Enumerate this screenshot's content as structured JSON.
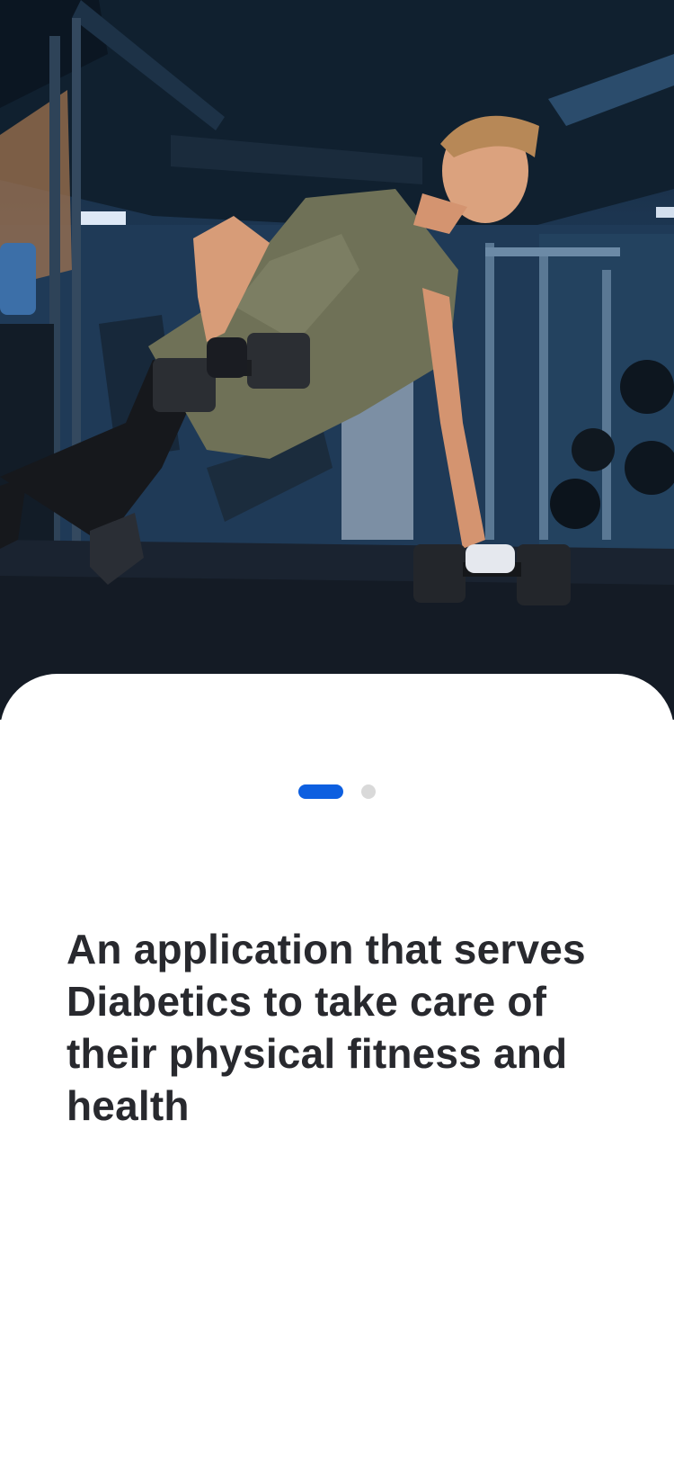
{
  "hero": {
    "image_icon": "fitness-photo",
    "subject": "man doing a single-arm dumbbell plank row in a gym"
  },
  "onboarding": {
    "pager": {
      "total_pages": 2,
      "current_page": 1,
      "active_color": "#0d5fe0",
      "inactive_color": "#d9d9d9"
    },
    "headline": "An application that serves Diabetics to take care of their physical fitness and health"
  },
  "colors": {
    "text_primary": "#28292e",
    "sheet_background": "#ffffff"
  }
}
